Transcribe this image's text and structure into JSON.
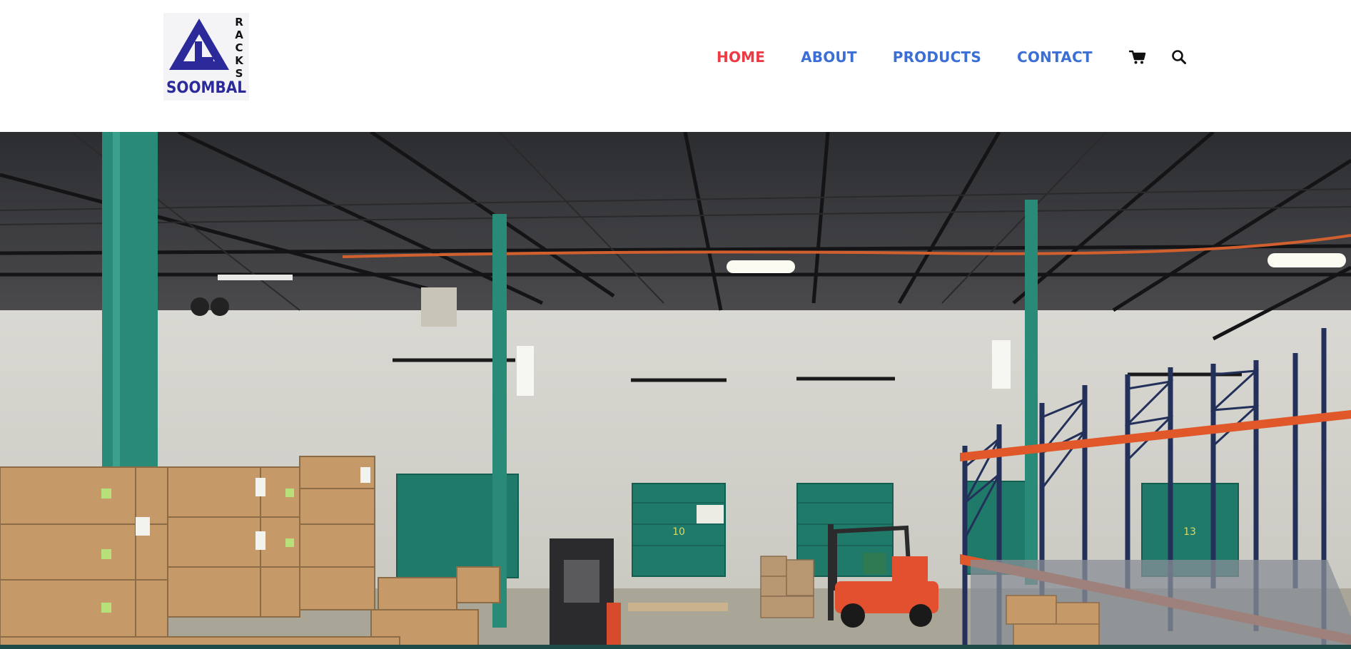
{
  "brand": {
    "name": "SOOMBAL",
    "tagline": "RACKS",
    "logo_colors": {
      "primary": "#2c2a9a",
      "text": "#111111",
      "background": "#f4f4f6"
    }
  },
  "nav": {
    "items": [
      {
        "label": "HOME",
        "active": true
      },
      {
        "label": "ABOUT",
        "active": false
      },
      {
        "label": "PRODUCTS",
        "active": false
      },
      {
        "label": "CONTACT",
        "active": false
      }
    ],
    "active_color": "#ee3a45",
    "link_color": "#3b6fd6",
    "icons": [
      "cart-icon",
      "search-icon"
    ]
  },
  "hero": {
    "image_subject": "warehouse-interior",
    "door_numbers": [
      "10",
      "13"
    ],
    "colors": {
      "columns": "#2a8a78",
      "rack_beams": "#e0572a",
      "rack_uprights": "#22305a",
      "boxes": "#c59a68",
      "forklift": "#e2502f"
    }
  }
}
